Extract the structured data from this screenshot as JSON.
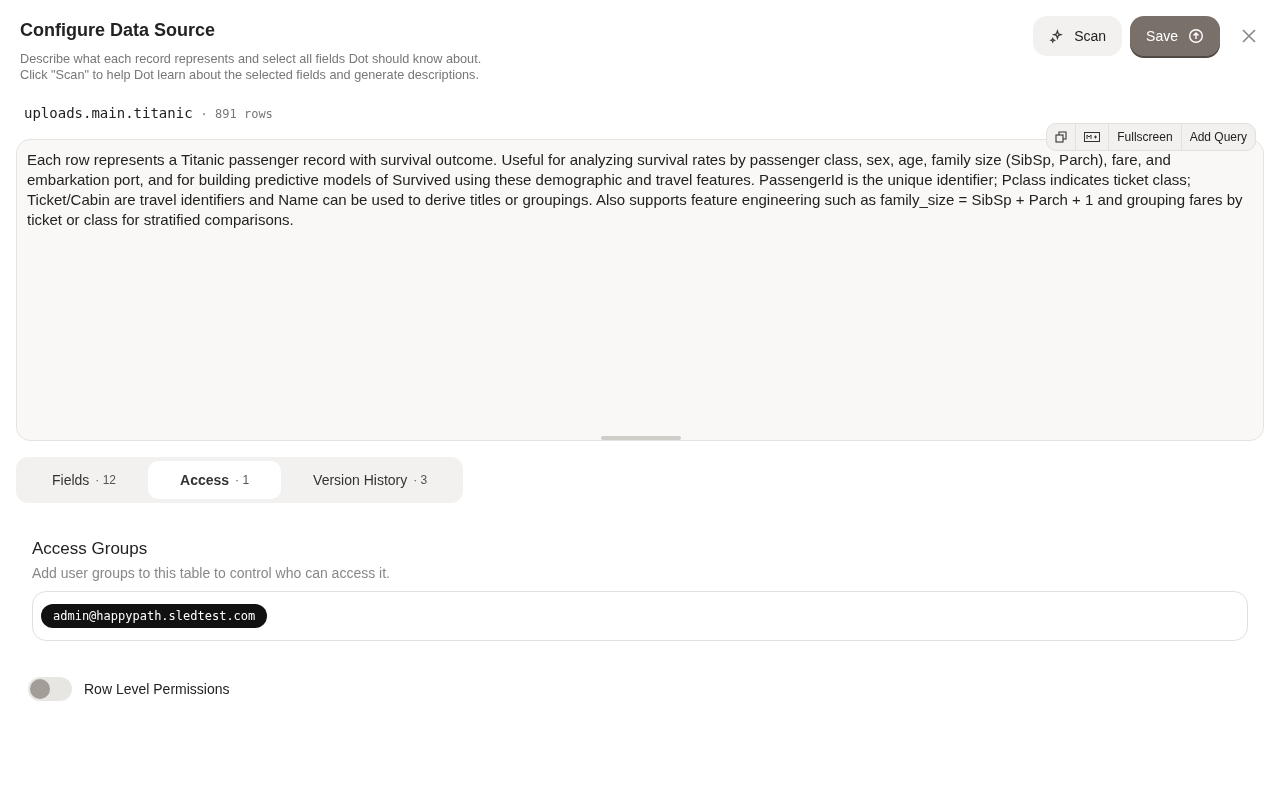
{
  "header": {
    "title": "Configure Data Source",
    "description_lines": [
      "Describe what each record represents and select all fields Dot should know about.",
      "Click \"Scan\" to help Dot learn about the selected fields and generate descriptions."
    ],
    "buttons": [
      {
        "kind": "scan",
        "label": "Scan"
      },
      {
        "kind": "save",
        "label": "Save"
      }
    ]
  },
  "table_ref": {
    "name": "uploads.main.titanic",
    "rows": "· 891 rows"
  },
  "editor": {
    "toolbar": [
      "Fullscreen",
      "Add Query"
    ],
    "value": "Each row represents a Titanic passenger record with survival outcome. Useful for analyzing survival rates by passenger class, sex, age, family size (SibSp, Parch), fare, and embarkation port, and for building predictive models of Survived using these demographic and travel features. PassengerId is the unique identifier; Pclass indicates ticket class; Ticket/Cabin are travel identifiers and Name can be used to derive titles or groupings. Also supports feature engineering such as family_size = SibSp + Parch + 1 and grouping fares by ticket or class for stratified comparisons."
  },
  "tabs": [
    {
      "label": "Fields",
      "count": "· 12",
      "selected": false
    },
    {
      "label": "Access",
      "count": "· 1",
      "selected": true
    },
    {
      "label": "Version History",
      "count": "· 3",
      "selected": false
    }
  ],
  "access_groups": {
    "title": "Access Groups",
    "subtitle": "Add user groups to this table to control who can access it.",
    "tags": [
      "admin@happypath.sledtest.com"
    ]
  },
  "row_level_permissions": {
    "label": "Row Level Permissions",
    "on": false
  }
}
